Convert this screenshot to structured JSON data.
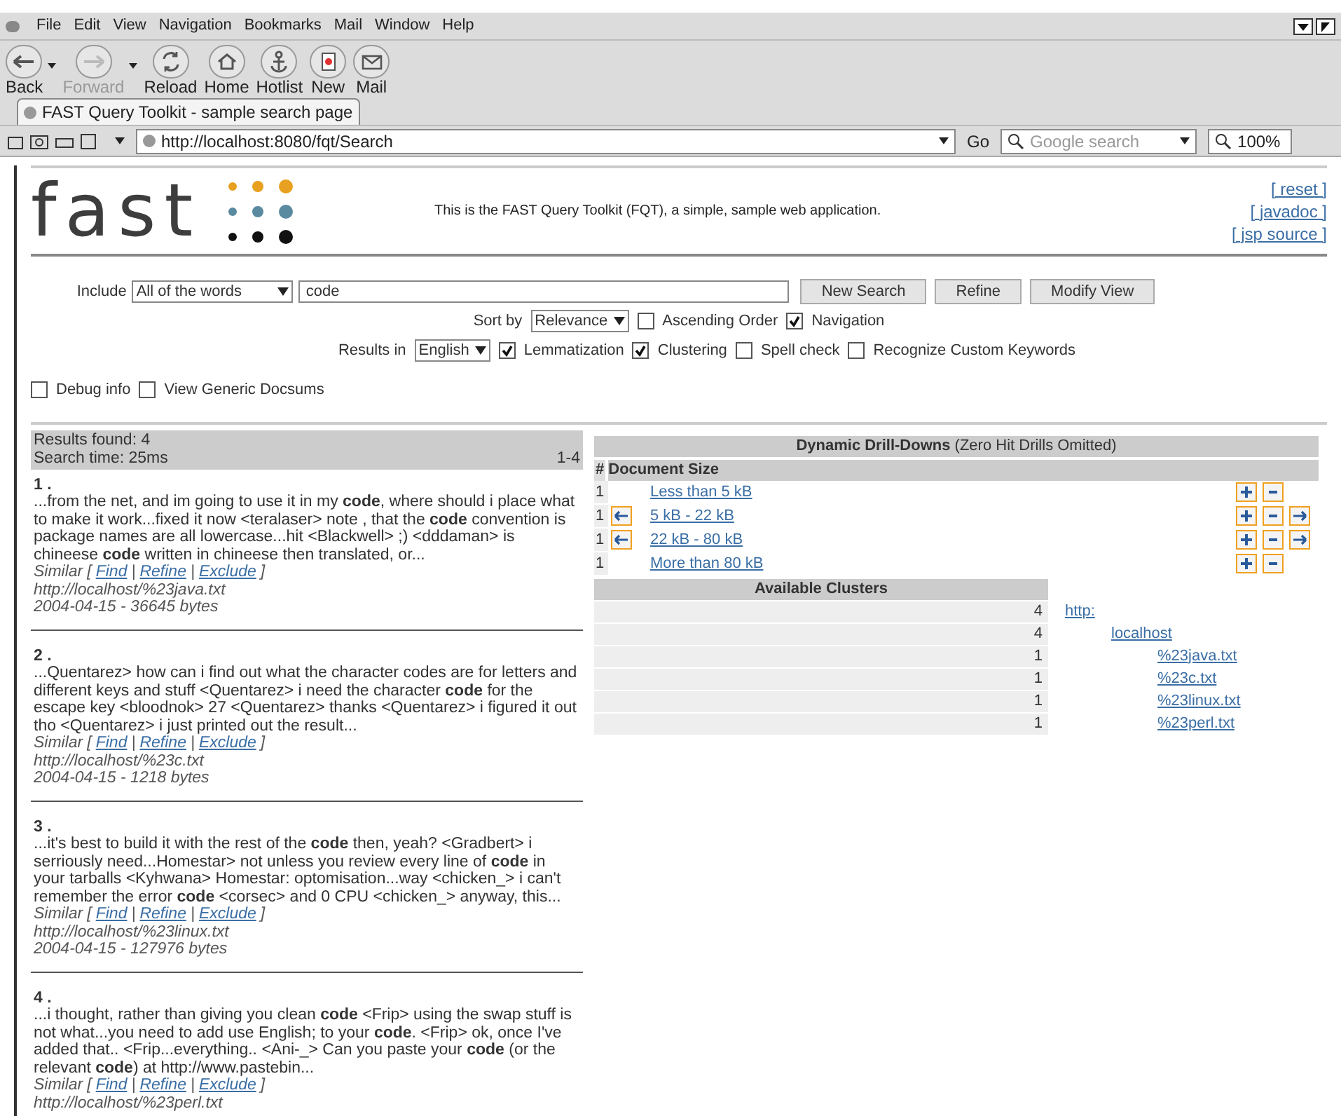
{
  "menu": [
    "File",
    "Edit",
    "View",
    "Navigation",
    "Bookmarks",
    "Mail",
    "Window",
    "Help"
  ],
  "toolbar": [
    {
      "label": "Back",
      "kind": "back",
      "disabled": false,
      "dropdown": true
    },
    {
      "label": "Forward",
      "kind": "forward",
      "disabled": true,
      "dropdown": true
    },
    {
      "label": "Reload",
      "kind": "reload",
      "disabled": false,
      "dropdown": false
    },
    {
      "label": "Home",
      "kind": "home",
      "disabled": false,
      "dropdown": false
    },
    {
      "label": "Hotlist",
      "kind": "hotlist",
      "disabled": false,
      "dropdown": false
    },
    {
      "label": "New",
      "kind": "new",
      "disabled": false,
      "dropdown": false
    },
    {
      "label": "Mail",
      "kind": "mail",
      "disabled": false,
      "dropdown": false
    }
  ],
  "tab": {
    "title": "FAST Query Toolkit - sample search page",
    "selected": true
  },
  "address_bar": {
    "url": "http://localhost:8080/fqt/Search",
    "go": "Go",
    "search_placeholder": "Google search",
    "zoom": "100%"
  },
  "header": {
    "logo": "fast",
    "description": "This is the FAST Query Toolkit (FQT), a simple, sample web application.",
    "links": [
      "[ reset ]",
      "[ javadoc ]",
      "[ jsp source ]"
    ]
  },
  "form": {
    "include_label": "Include",
    "include_value": "All of the words",
    "query": "code",
    "buttons": [
      "New Search",
      "Refine",
      "Modify View"
    ],
    "sort_label": "Sort by",
    "sort_value": "Relevance",
    "sort_options": [
      {
        "label": "Ascending Order",
        "checked": false
      },
      {
        "label": "Navigation",
        "checked": true
      }
    ],
    "results_label": "Results in",
    "language": "English",
    "result_options": [
      {
        "label": "Lemmatization",
        "checked": true
      },
      {
        "label": "Clustering",
        "checked": true
      },
      {
        "label": "Spell check",
        "checked": false
      },
      {
        "label": "Recognize Custom Keywords",
        "checked": false
      }
    ],
    "debug_options": [
      {
        "label": "Debug info",
        "checked": false
      },
      {
        "label": "View Generic Docsums",
        "checked": false
      }
    ]
  },
  "results": {
    "found": "Results found: 4",
    "time": "Search time: 25ms",
    "range": "1-4",
    "items": [
      {
        "number": "1 .",
        "snippet": "...from the net, and im going to use it in my **code**, where should i place what to make it work...fixed it now <teralaser> note , that the **code** convention is package names are all lowercase...hit <Blackwell> ;) <dddaman> is chineese **code** written in chineese then translated, or...",
        "similar": "Similar",
        "open": "[",
        "separator": "|",
        "close": "]",
        "actions": [
          "Find",
          "Refine",
          "Exclude"
        ],
        "url": "http://localhost/%23java.txt",
        "meta": "2004-04-15 - 36645 bytes"
      },
      {
        "number": "2 .",
        "snippet": "...Quentarez> how can i find out what the character codes are for letters and different keys and stuff <Quentarez> i need the character **code** for the escape key <bloodnok> 27 <Quentarez> thanks <Quentarez> i figured it out tho <Quentarez> i just printed out the result...",
        "similar": "Similar",
        "open": "[",
        "separator": "|",
        "close": "]",
        "actions": [
          "Find",
          "Refine",
          "Exclude"
        ],
        "url": "http://localhost/%23c.txt",
        "meta": "2004-04-15 - 1218 bytes"
      },
      {
        "number": "3 .",
        "snippet": "...it's best to build it with the rest of the **code** then, yeah? <Gradbert> i serriously need...Homestar> not unless you review every line of **code** in your tarballs <Kyhwana> Homestar: optomisation...way <chicken_> i can't remember the error **code** <corsec> and 0 CPU <chicken_> anyway, this...",
        "similar": "Similar",
        "open": "[",
        "separator": "|",
        "close": "]",
        "actions": [
          "Find",
          "Refine",
          "Exclude"
        ],
        "url": "http://localhost/%23linux.txt",
        "meta": "2004-04-15 - 127976 bytes"
      },
      {
        "number": "4 .",
        "snippet": "...i thought, rather than giving you clean **code** <Frip> using the swap stuff is not what...you need to add use English; to your **code**. <Frip> ok, once I've added that.. <Frip...everything.. <Ani-_> Can you paste your **code** (or the relevant **code**) at http://www.pastebin...",
        "similar": "Similar",
        "open": "[",
        "separator": "|",
        "close": "]",
        "actions": [
          "Find",
          "Refine",
          "Exclude"
        ],
        "url": "http://localhost/%23perl.txt"
      }
    ]
  },
  "drilldowns": {
    "title": "**Dynamic Drill-Downs** (Zero Hit Drills Omitted)",
    "hash": "#",
    "group": "Document Size",
    "rows": [
      {
        "count": "1",
        "label": "Less than 5 kB",
        "left": false,
        "right": false
      },
      {
        "count": "1",
        "label": "5 kB - 22 kB",
        "left": true,
        "right": true
      },
      {
        "count": "1",
        "label": "22 kB - 80 kB",
        "left": true,
        "right": true
      },
      {
        "count": "1",
        "label": "More than 80 kB",
        "left": false,
        "right": false
      }
    ]
  },
  "clusters": {
    "title": "Available Clusters",
    "items": [
      {
        "count": "4",
        "label": "http:",
        "children": [
          {
            "count": "4",
            "label": "localhost",
            "children": [
              {
                "count": "1",
                "label": "%23java.txt"
              },
              {
                "count": "1",
                "label": "%23c.txt"
              },
              {
                "count": "1",
                "label": "%23linux.txt"
              },
              {
                "count": "1",
                "label": "%23perl.txt"
              }
            ]
          }
        ]
      }
    ]
  }
}
